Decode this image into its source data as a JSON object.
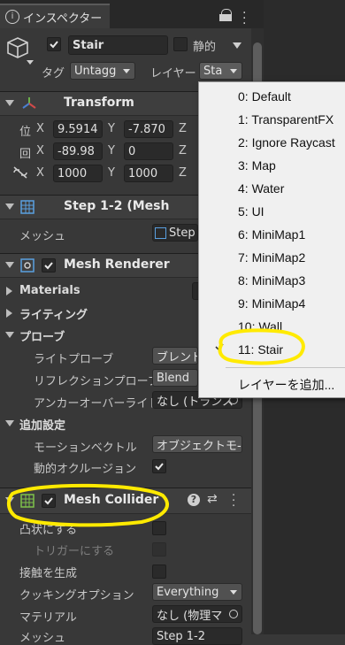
{
  "tab": {
    "title": "インスペクター"
  },
  "object": {
    "name": "Stair",
    "static_label": "静的",
    "tag_label": "タグ",
    "tag_value": "Untagg",
    "layer_label": "レイヤー",
    "layer_value": "Sta"
  },
  "transform": {
    "title": "Transform",
    "pos_label": "位",
    "rot_label": "回",
    "pos": {
      "x": "9.5914",
      "y": "-7.870",
      "z": "Z"
    },
    "rot": {
      "x": "-89.98",
      "y": "0",
      "z": "Z"
    },
    "scale": {
      "x": "1000",
      "y": "1000",
      "z": "Z"
    },
    "x_label": "X",
    "y_label": "Y"
  },
  "mesh_filter": {
    "title": "Step 1-2 (Mesh",
    "mesh_label": "メッシュ",
    "mesh_value": "Step"
  },
  "mesh_renderer": {
    "title": "Mesh Renderer",
    "materials": "Materials",
    "lighting": "ライティング",
    "probes": "プローブ",
    "light_probe": "ライトプローブ",
    "light_probe_value": "ブレンドフ",
    "reflection_probe": "リフレクションプローブ",
    "reflection_probe_value": "Blend",
    "anchor_override": "アンカーオーバーライド",
    "anchor_override_value": "なし (トランス",
    "extra": "追加設定",
    "motion_vector": "モーションベクトル",
    "motion_vector_value": "オブジェクトモ-",
    "dynamic_occlusion": "動的オクルージョン"
  },
  "mesh_collider": {
    "title": "Mesh Collider",
    "convex": "凸状にする",
    "trigger": "トリガーにする",
    "contacts": "接触を生成",
    "cooking": "クッキングオプション",
    "cooking_value": "Everything",
    "material": "マテリアル",
    "material_value": "なし (物理マ",
    "mesh": "メッシュ",
    "mesh_value": "Step 1-2"
  },
  "layer_menu": {
    "items": [
      "0: Default",
      "1: TransparentFX",
      "2: Ignore Raycast",
      "3: Map",
      "4: Water",
      "5: UI",
      "6: MiniMap1",
      "7: MiniMap2",
      "8: MiniMap3",
      "9: MiniMap4",
      "10: Wall",
      "11: Stair"
    ],
    "selected": "11: Stair",
    "add_layer": "レイヤーを追加..."
  },
  "colors": {
    "highlight": "#ffea00",
    "menu_bg": "#f0f0f0",
    "panel_bg": "#383838"
  }
}
